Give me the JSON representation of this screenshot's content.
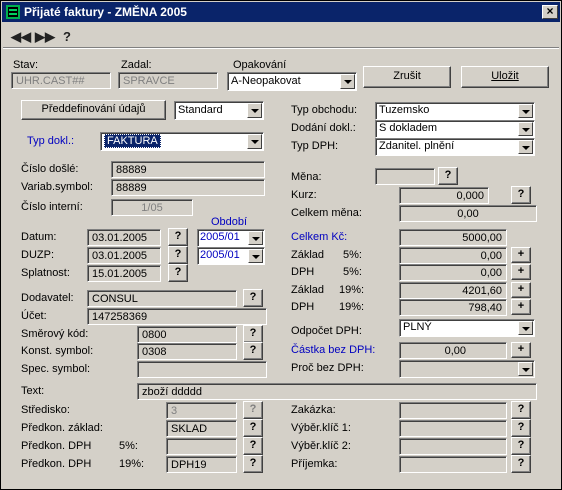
{
  "window": {
    "title": "Přijaté faktury - ZMĚNA 2005",
    "close": "×"
  },
  "toolbar": {
    "back": "◀◀",
    "forward": "▶▶",
    "help": "?"
  },
  "header": {
    "stav_label": "Stav:",
    "stav_value": "UHR.CAST##",
    "zadal_label": "Zadal:",
    "zadal_value": "SPRAVCE",
    "opakovani_label": "Opakování",
    "opakovani_value": "A-Neopakovat",
    "zrusit": "Zrušit",
    "ulozit": "Uložit"
  },
  "left": {
    "predefinovani": "Předdefinování údajů",
    "standard": "Standard",
    "typ_dokl_label": "Typ dokl.:",
    "typ_dokl_value": "FAKTURA",
    "cislo_dosle_label": "Číslo došlé:",
    "cislo_dosle_value": "88889",
    "variab_label": "Variab.symbol:",
    "variab_value": "88889",
    "cislo_int_label": "Číslo interní:",
    "cislo_int_value": "1/05",
    "obdobi_label": "Období",
    "datum_label": "Datum:",
    "datum_value": "03.01.2005",
    "obdobi1": "2005/01",
    "duzp_label": "DUZP:",
    "duzp_value": "03.01.2005",
    "obdobi2": "2005/01",
    "splatnost_label": "Splatnost:",
    "splatnost_value": "15.01.2005",
    "dodavatel_label": "Dodavatel:",
    "dodavatel_value": "CONSUL",
    "ucet_label": "Účet:",
    "ucet_value": "147258369",
    "smerovy_label": "Směrový kód:",
    "smerovy_value": "0800",
    "konst_label": "Konst. symbol:",
    "konst_value": "0308",
    "spec_label": "Spec. symbol:",
    "spec_value": ""
  },
  "right": {
    "typ_obchodu_label": "Typ obchodu:",
    "typ_obchodu_value": "Tuzemsko",
    "dodani_label": "Dodání dokl.:",
    "dodani_value": "S dokladem",
    "typ_dph_label": "Typ DPH:",
    "typ_dph_value": "Zdanitel. plnění",
    "mena_label": "Měna:",
    "mena_value": "",
    "kurz_label": "Kurz:",
    "kurz_value": "0,000",
    "celkem_mena_label": "Celkem měna:",
    "celkem_mena_value": "0,00",
    "celkem_kc_label": "Celkem Kč:",
    "celkem_kc_value": "5000,00",
    "zaklad5_label": "Základ",
    "zaklad5_pct": "5%:",
    "zaklad5_value": "0,00",
    "dph5_label": "DPH",
    "dph5_pct": "5%:",
    "dph5_value": "0,00",
    "zaklad19_label": "Základ",
    "zaklad19_pct": "19%:",
    "zaklad19_value": "4201,60",
    "dph19_label": "DPH",
    "dph19_pct": "19%:",
    "dph19_value": "798,40",
    "odpocet_label": "Odpočet DPH:",
    "odpocet_value": "PLNÝ",
    "castka_label": "Částka bez DPH:",
    "castka_value": "0,00",
    "proc_label": "Proč bez DPH:",
    "proc_value": ""
  },
  "bottom": {
    "text_label": "Text:",
    "text_value": "zboží ddddd",
    "stredisko_label": "Středisko:",
    "stredisko_value": "3",
    "predkon_zaklad_label": "Předkon. základ:",
    "predkon_zaklad_value": "SKLAD",
    "predkon_dph5_label": "Předkon. DPH",
    "predkon_dph5_pct": "5%:",
    "predkon_dph5_value": "",
    "predkon_dph19_label": "Předkon. DPH",
    "predkon_dph19_pct": "19%:",
    "predkon_dph19_value": "DPH19",
    "zakazka_label": "Zakázka:",
    "zakazka_value": "",
    "vyber1_label": "Výběr.klíč 1:",
    "vyber1_value": "",
    "vyber2_label": "Výběr.klíč 2:",
    "vyber2_value": "",
    "prijemka_label": "Příjemka:",
    "prijemka_value": ""
  },
  "q": "?",
  "plus": "+"
}
